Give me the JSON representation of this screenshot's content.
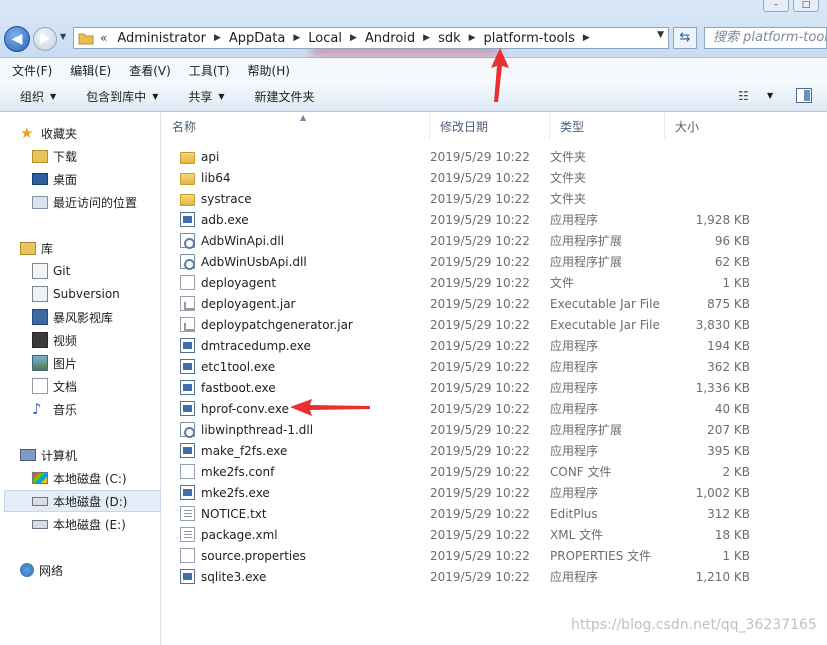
{
  "window": {
    "title_blur": "..."
  },
  "address_bar": {
    "overflow": "«",
    "crumbs": [
      "Administrator",
      "AppData",
      "Local",
      "Android",
      "sdk",
      "platform-tools"
    ],
    "search_placeholder": "搜索 platform-tools"
  },
  "menu": [
    "文件(F)",
    "编辑(E)",
    "查看(V)",
    "工具(T)",
    "帮助(H)"
  ],
  "toolbar": {
    "organize": "组织",
    "include_in_library": "包含到库中",
    "share": "共享",
    "new_folder": "新建文件夹"
  },
  "sidebar": {
    "favorites": "收藏夹",
    "favorites_items": [
      "下载",
      "桌面",
      "最近访问的位置"
    ],
    "libraries": "库",
    "library_items": [
      "Git",
      "Subversion",
      "暴风影视库",
      "视频",
      "图片",
      "文档",
      "音乐"
    ],
    "computer": "计算机",
    "drives": [
      "本地磁盘 (C:)",
      "本地磁盘 (D:)",
      "本地磁盘 (E:)"
    ],
    "network": "网络"
  },
  "columns": {
    "name": "名称",
    "date": "修改日期",
    "type": "类型",
    "size": "大小"
  },
  "files": [
    {
      "name": "api",
      "date": "2019/5/29 10:22",
      "type": "文件夹",
      "size": "",
      "icon": "folder-icon"
    },
    {
      "name": "lib64",
      "date": "2019/5/29 10:22",
      "type": "文件夹",
      "size": "",
      "icon": "folder-icon"
    },
    {
      "name": "systrace",
      "date": "2019/5/29 10:22",
      "type": "文件夹",
      "size": "",
      "icon": "folder-icon"
    },
    {
      "name": "adb.exe",
      "date": "2019/5/29 10:22",
      "type": "应用程序",
      "size": "1,928 KB",
      "icon": "exe-icon"
    },
    {
      "name": "AdbWinApi.dll",
      "date": "2019/5/29 10:22",
      "type": "应用程序扩展",
      "size": "96 KB",
      "icon": "dll-icon"
    },
    {
      "name": "AdbWinUsbApi.dll",
      "date": "2019/5/29 10:22",
      "type": "应用程序扩展",
      "size": "62 KB",
      "icon": "dll-icon"
    },
    {
      "name": "deployagent",
      "date": "2019/5/29 10:22",
      "type": "文件",
      "size": "1 KB",
      "icon": "file-icon"
    },
    {
      "name": "deployagent.jar",
      "date": "2019/5/29 10:22",
      "type": "Executable Jar File",
      "size": "875 KB",
      "icon": "jar-icon"
    },
    {
      "name": "deploypatchgenerator.jar",
      "date": "2019/5/29 10:22",
      "type": "Executable Jar File",
      "size": "3,830 KB",
      "icon": "jar-icon"
    },
    {
      "name": "dmtracedump.exe",
      "date": "2019/5/29 10:22",
      "type": "应用程序",
      "size": "194 KB",
      "icon": "exe-icon"
    },
    {
      "name": "etc1tool.exe",
      "date": "2019/5/29 10:22",
      "type": "应用程序",
      "size": "362 KB",
      "icon": "exe-icon"
    },
    {
      "name": "fastboot.exe",
      "date": "2019/5/29 10:22",
      "type": "应用程序",
      "size": "1,336 KB",
      "icon": "exe-icon"
    },
    {
      "name": "hprof-conv.exe",
      "date": "2019/5/29 10:22",
      "type": "应用程序",
      "size": "40 KB",
      "icon": "exe-icon"
    },
    {
      "name": "libwinpthread-1.dll",
      "date": "2019/5/29 10:22",
      "type": "应用程序扩展",
      "size": "207 KB",
      "icon": "dll-icon"
    },
    {
      "name": "make_f2fs.exe",
      "date": "2019/5/29 10:22",
      "type": "应用程序",
      "size": "395 KB",
      "icon": "exe-icon"
    },
    {
      "name": "mke2fs.conf",
      "date": "2019/5/29 10:22",
      "type": "CONF 文件",
      "size": "2 KB",
      "icon": "file-icon"
    },
    {
      "name": "mke2fs.exe",
      "date": "2019/5/29 10:22",
      "type": "应用程序",
      "size": "1,002 KB",
      "icon": "exe-icon"
    },
    {
      "name": "NOTICE.txt",
      "date": "2019/5/29 10:22",
      "type": "EditPlus",
      "size": "312 KB",
      "icon": "txt-icon"
    },
    {
      "name": "package.xml",
      "date": "2019/5/29 10:22",
      "type": "XML 文件",
      "size": "18 KB",
      "icon": "txt-icon"
    },
    {
      "name": "source.properties",
      "date": "2019/5/29 10:22",
      "type": "PROPERTIES 文件",
      "size": "1 KB",
      "icon": "file-icon"
    },
    {
      "name": "sqlite3.exe",
      "date": "2019/5/29 10:22",
      "type": "应用程序",
      "size": "1,210 KB",
      "icon": "exe-icon"
    }
  ],
  "watermark": "https://blog.csdn.net/qq_36237165"
}
